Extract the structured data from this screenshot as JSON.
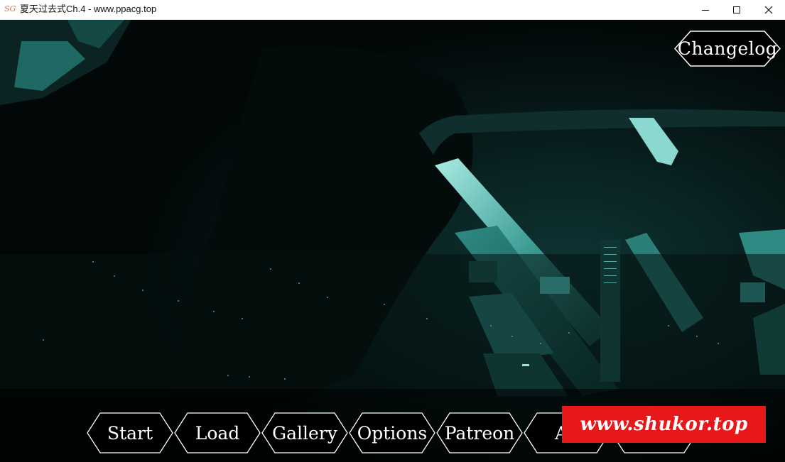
{
  "window": {
    "app_icon_text": "SG",
    "title": "夏天过去式Ch.4 - www.ppacg.top",
    "minimize_icon": "minimize-icon",
    "maximize_icon": "maximize-icon",
    "close_icon": "close-icon"
  },
  "colors": {
    "teal_light": "#7fd6cc",
    "teal_dark": "#1c5a58",
    "watermark_red": "#e8171a"
  },
  "changelog": {
    "label": "Changelog"
  },
  "menu": {
    "items": [
      {
        "label": "Start"
      },
      {
        "label": "Load"
      },
      {
        "label": "Gallery"
      },
      {
        "label": "Options"
      },
      {
        "label": "Patreon"
      },
      {
        "label": "Ab"
      },
      {
        "label": ""
      }
    ]
  },
  "watermark": {
    "text": "www.shukor.top"
  }
}
